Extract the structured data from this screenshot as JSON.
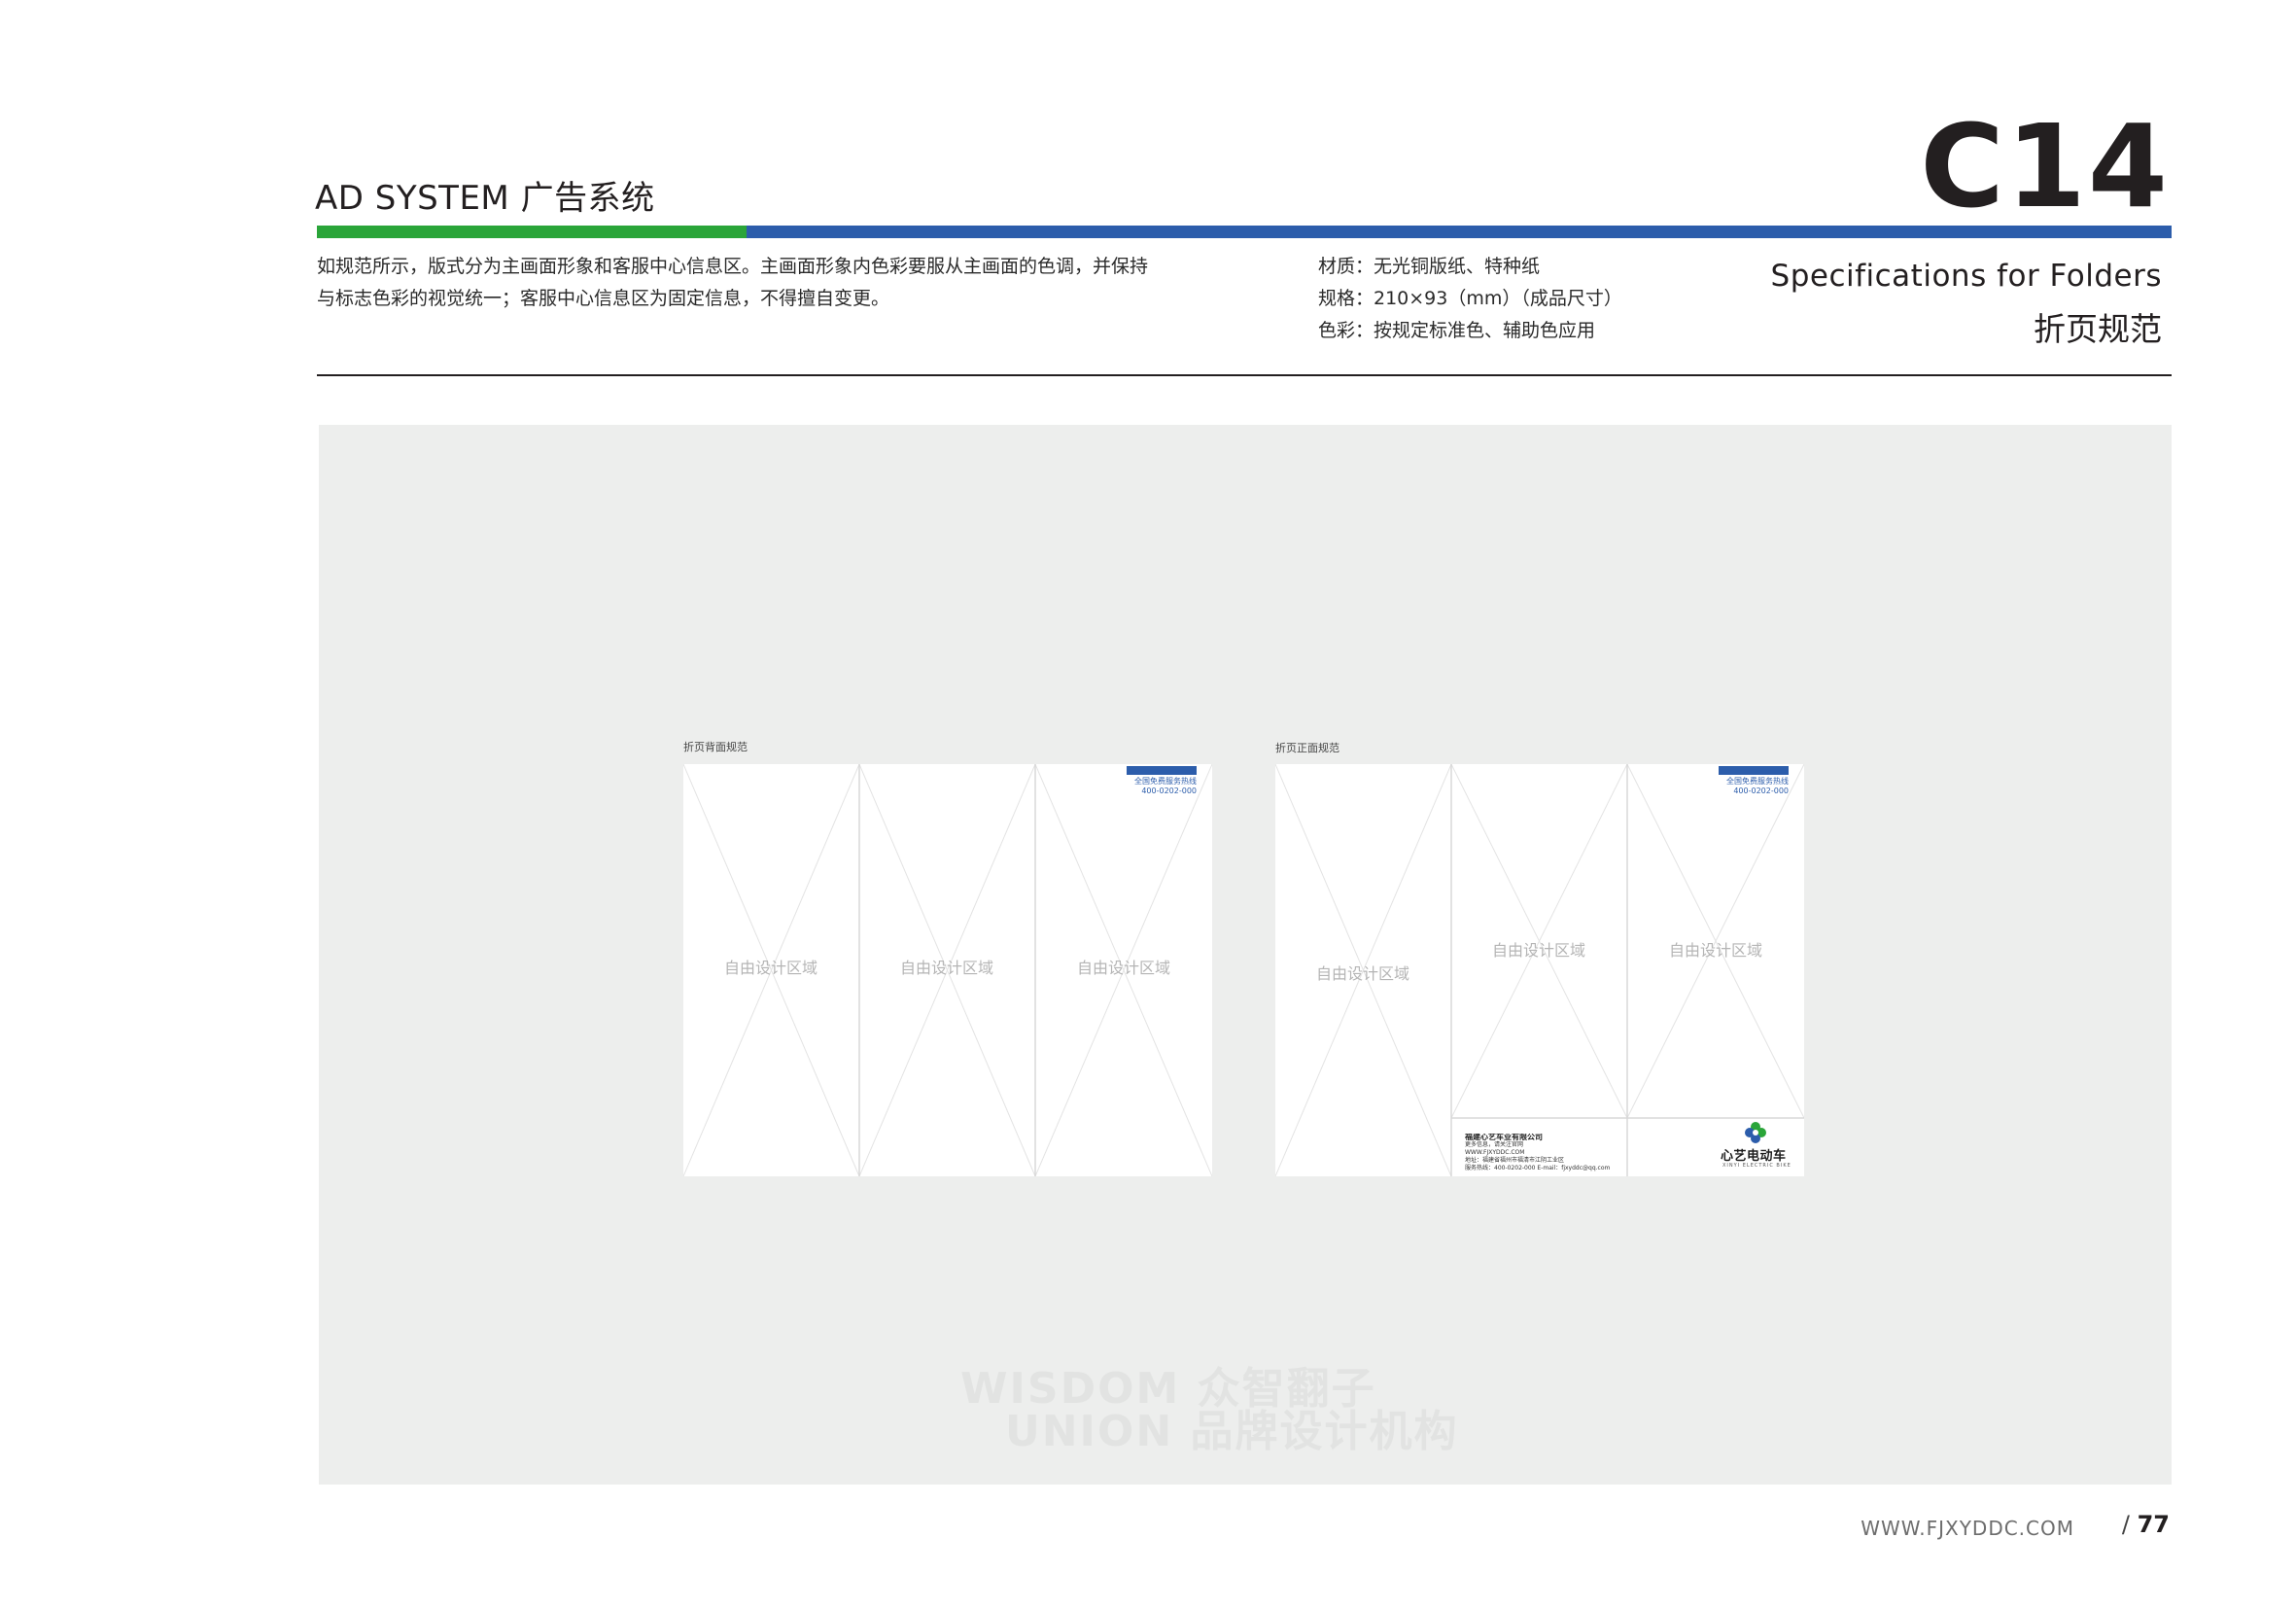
{
  "header": {
    "section_title": "AD SYSTEM 广告系统",
    "page_code": "C14",
    "description_lines": [
      "如规范所示，版式分为主画面形象和客服中心信息区。主画面形象内色彩要服从主画面的色调，并保持",
      "与标志色彩的视觉统一；客服中心信息区为固定信息，不得擅自变更。"
    ],
    "specs": [
      "材质：无光铜版纸、特种纸",
      "规格：210×93（mm）（成品尺寸）",
      "色彩：按规定标准色、辅助色应用"
    ],
    "spec_title_en": "Specifications for  Folders",
    "spec_title_cn": "折页规范"
  },
  "colors": {
    "brand_green": "#2aa539",
    "brand_blue": "#2c5dab",
    "stage_grey": "#edeeed"
  },
  "back_panel": {
    "label": "折页背面规范",
    "zones": [
      "自由设计区域",
      "自由设计区域",
      "自由设计区域"
    ],
    "hotline_lines": [
      "全国免费服务热线",
      "400-0202-000"
    ]
  },
  "front_panel": {
    "label": "折页正面规范",
    "zones": [
      "自由设计区域",
      "自由设计区域",
      "自由设计区域"
    ],
    "hotline_lines": [
      "全国免费服务热线",
      "400-0202-000"
    ],
    "company_block": {
      "name": "福建心艺车业有限公司",
      "lines": [
        "更多信息，请关注官网",
        "WWW.FJXYDDC.COM",
        "地址：福建省福州市福清市江阴工业区",
        "服务热线：400-0202-000  E-mail：fjxyddc@qq.com"
      ]
    },
    "brand_icon": "clover-logo-icon",
    "brand_name": "心艺电动车",
    "brand_sub": "XINYI ELECTRIC BIKE"
  },
  "watermark": {
    "line1": "WISDOM 众智翻子",
    "line2": "UNION 品牌设计机构"
  },
  "footer": {
    "url": "WWW.FJXYDDC.COM",
    "page_prefix": "/",
    "page_number": "77"
  }
}
